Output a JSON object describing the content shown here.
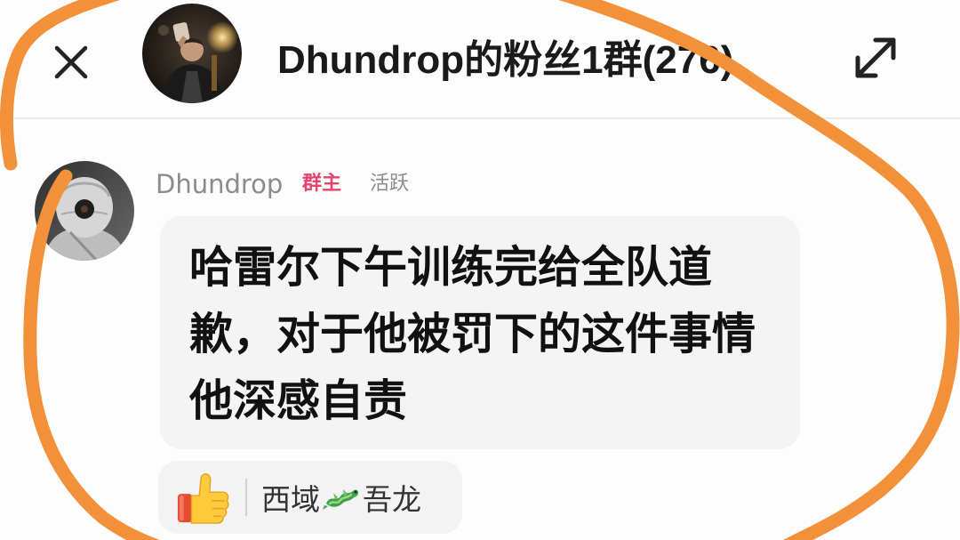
{
  "header": {
    "title": "Dhundrop的粉丝1群(276)",
    "close_icon": "close-icon",
    "expand_icon": "expand-icon",
    "avatar": "group-avatar"
  },
  "message": {
    "sender": "Dhundrop",
    "role_badge": "群主",
    "activity_badge": "活跃",
    "lines": [
      "哈雷尔下午训练完给全队道",
      "歉，对于他被罚下的这件事情",
      "他深感自责"
    ],
    "avatar": "sender-avatar"
  },
  "reaction": {
    "icon": "thumbs-up-icon",
    "reactor_name_before": "西域",
    "reactor_emoji": "dragon-icon",
    "reactor_name_after": "吾龙"
  },
  "colors": {
    "background": "#fdfdfd",
    "title": "#1a1a1a",
    "sender_name": "#8c8c8c",
    "role_badge": "#e8436c",
    "activity_badge": "#8c8c8c",
    "bubble": "#f4f4f4",
    "message_text": "#111111",
    "reaction_bg": "#f3f3f3",
    "annotation": "#f2913a"
  }
}
